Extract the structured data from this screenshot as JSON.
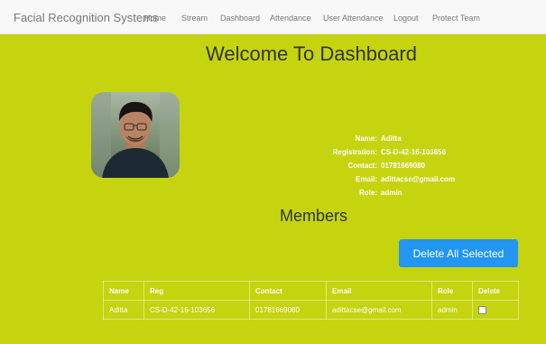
{
  "navbar": {
    "brand": "Facial Recognition Systems",
    "links": [
      "Home",
      "Stream",
      "Dashboard",
      "Attendance",
      "User Attendance",
      "Logout",
      "Protect Team"
    ]
  },
  "page": {
    "title": "Welcome To Dashboard"
  },
  "profile": {
    "name_label": "Name:",
    "name": "Aditta",
    "registration_label": "Registration:",
    "registration": "CS-D-42-16-103656",
    "contact_label": "Contact:",
    "contact": "01781669080",
    "email_label": "Email:",
    "email": "adittacse@gmail.com",
    "role_label": "Role:",
    "role": "admin"
  },
  "members": {
    "title": "Members",
    "delete_all_label": "Delete All Selected",
    "columns": [
      "Name",
      "Reg",
      "Contact",
      "Email",
      "Role",
      "Delete"
    ],
    "rows": [
      {
        "name": "Aditta",
        "reg": "CS-D-42-16-103656",
        "contact": "01781669080",
        "email": "adittacse@gmail.com",
        "role": "admin",
        "delete_checked": false
      }
    ]
  },
  "colors": {
    "background": "#c5d40f",
    "navbar": "#f8f8f8",
    "primary_button": "#2196f3"
  }
}
